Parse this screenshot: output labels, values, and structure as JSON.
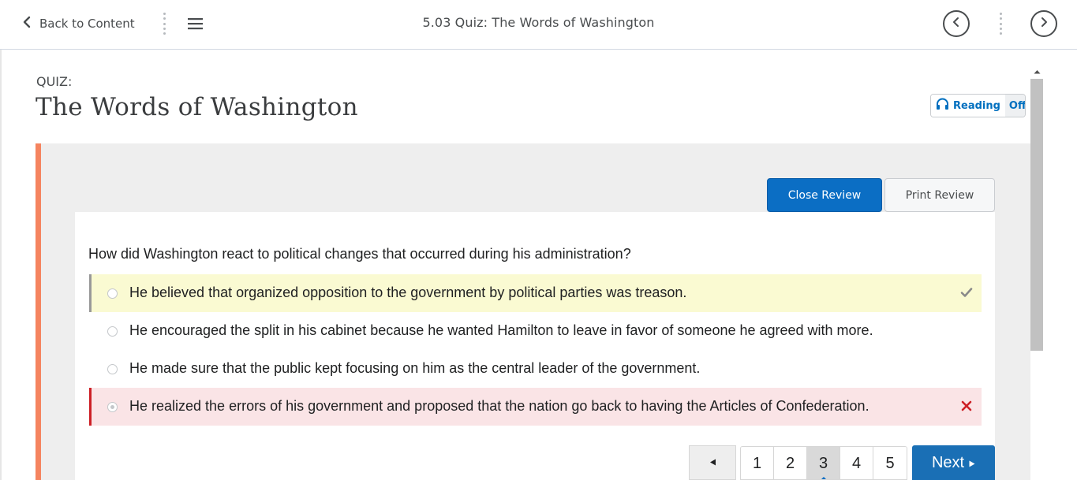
{
  "nav": {
    "back_label": "Back to Content",
    "title": "5.03 Quiz: The Words of Washington"
  },
  "quiz": {
    "label": "QUIZ:",
    "title": "The Words of Washington"
  },
  "reading": {
    "label": "Reading",
    "state": "Off"
  },
  "review": {
    "close_label": "Close Review",
    "print_label": "Print Review"
  },
  "question": {
    "text": "How did Washington react to political changes that occurred during his administration?",
    "answers": [
      {
        "text": "He believed that organized opposition to the government by political parties was treason.",
        "status": "correct",
        "selected": false
      },
      {
        "text": "He encouraged the split in his cabinet because he wanted Hamilton to leave in favor of someone he agreed with more.",
        "status": "none",
        "selected": false
      },
      {
        "text": "He made sure that the public kept focusing on him as the central leader of the government.",
        "status": "none",
        "selected": false
      },
      {
        "text": "He realized the errors of his government and proposed that the nation go back to having the Articles of Confederation.",
        "status": "incorrect",
        "selected": true
      }
    ]
  },
  "pagination": {
    "pages": [
      "1",
      "2",
      "3",
      "4",
      "5"
    ],
    "current": "3",
    "next_label": "Next"
  },
  "colors": {
    "accent_blue": "#0b6ec4",
    "panel_accent": "#f5845f",
    "correct_bg": "#fafad2",
    "incorrect_bg": "#fae4e6",
    "incorrect_mark": "#cd2026"
  },
  "icons": {
    "back": "chevron-left-icon",
    "menu": "hamburger-icon",
    "prev_topic": "circle-chevron-left-icon",
    "next_topic": "circle-chevron-right-icon",
    "reading": "headphones-icon",
    "correct": "checkmark-icon",
    "incorrect": "x-icon"
  }
}
